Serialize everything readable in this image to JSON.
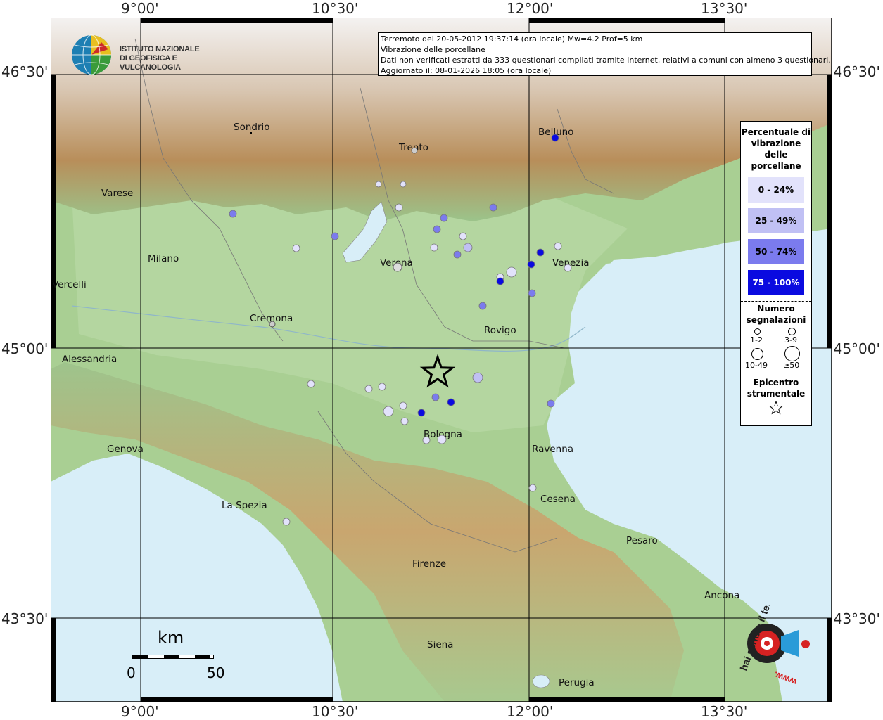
{
  "header": {
    "line1": "Terremoto del 20-05-2012 19:37:14 (ora locale) Mw=4.2 Prof=5 km",
    "line2": "Vibrazione delle porcellane",
    "line3": "Dati non verificati estratti da 333 questionari compilati tramite Internet, relativi a comuni con almeno 3 questionari.",
    "line4": "Aggiornato il: 08-01-2026 18:05 (ora locale)"
  },
  "logo": {
    "line1": "ISTITUTO NAZIONALE",
    "line2": "DI GEOFISICA E VULCANOLOGIA"
  },
  "axes": {
    "top": [
      "9°00'",
      "10°30'",
      "12°00'",
      "13°30'"
    ],
    "bottom": [
      "9°00'",
      "10°30'",
      "12°00'",
      "13°30'"
    ],
    "left": [
      "46°30'",
      "45°00'",
      "43°30'"
    ],
    "right": [
      "46°30'",
      "45°00'",
      "43°30'"
    ]
  },
  "legend": {
    "title": "Percentuale di vibrazione delle porcellane",
    "classes": [
      {
        "label": "0 - 24%",
        "color": "#e2e2fb"
      },
      {
        "label": "25 - 49%",
        "color": "#c0c0f4"
      },
      {
        "label": "50 - 74%",
        "color": "#7b7bee"
      },
      {
        "label": "75 - 100%",
        "color": "#0a0ae0"
      }
    ],
    "count_title": "Numero segnalazioni",
    "count_labels": [
      "1-2",
      "3-9",
      "10-49",
      "≥50"
    ],
    "epicenter_title": "Epicentro strumentale"
  },
  "scale": {
    "unit": "km",
    "min": "0",
    "max": "50"
  },
  "watermark": {
    "site": "hai sentito il terremoto.it",
    "url": "www."
  },
  "cities": [
    {
      "name": "Sondrio"
    },
    {
      "name": "Trento"
    },
    {
      "name": "Belluno"
    },
    {
      "name": "Varese"
    },
    {
      "name": "Milano"
    },
    {
      "name": "Verona"
    },
    {
      "name": "Venezia"
    },
    {
      "name": "Vercelli"
    },
    {
      "name": "Cremona"
    },
    {
      "name": "Rovigo"
    },
    {
      "name": "Alessandria"
    },
    {
      "name": "Bologna"
    },
    {
      "name": "Genova"
    },
    {
      "name": "Ravenna"
    },
    {
      "name": "La Spezia"
    },
    {
      "name": "Cesena"
    },
    {
      "name": "Pesaro"
    },
    {
      "name": "Firenze"
    },
    {
      "name": "Ancona"
    },
    {
      "name": "Siena"
    },
    {
      "name": "Perugia"
    }
  ],
  "observations": [
    {
      "name": "obs-1",
      "pct_class": 4,
      "count_class": 1
    },
    {
      "name": "obs-2",
      "pct_class": 2,
      "count_class": 1
    }
  ]
}
